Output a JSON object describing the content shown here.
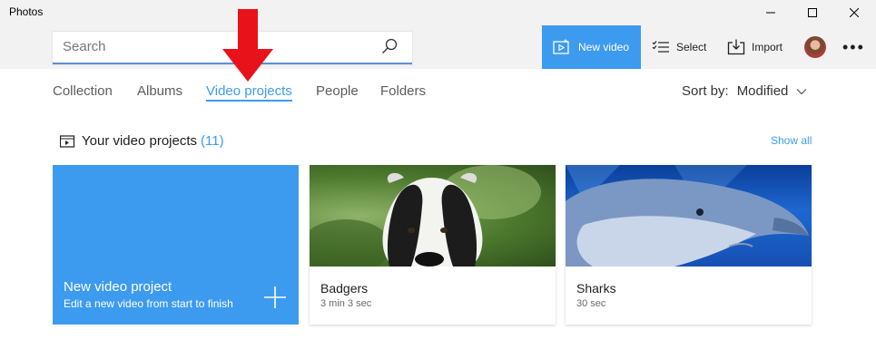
{
  "app": {
    "title": "Photos"
  },
  "search": {
    "placeholder": "Search",
    "value": ""
  },
  "toolbar": {
    "new_video_label": "New video",
    "select_label": "Select",
    "import_label": "Import",
    "more_label": "•••"
  },
  "tabs": [
    {
      "label": "Collection",
      "active": false
    },
    {
      "label": "Albums",
      "active": false
    },
    {
      "label": "Video projects",
      "active": true
    },
    {
      "label": "People",
      "active": false
    },
    {
      "label": "Folders",
      "active": false
    }
  ],
  "sort": {
    "label": "Sort by:",
    "value": "Modified"
  },
  "section": {
    "title": "Your video projects",
    "count": "(11)",
    "show_all": "Show all"
  },
  "cards": {
    "new_project": {
      "title": "New video project",
      "subtitle": "Edit a new video from start to finish"
    },
    "projects": [
      {
        "name": "Badgers",
        "duration": "3 min 3 sec"
      },
      {
        "name": "Sharks",
        "duration": "30 sec"
      }
    ]
  },
  "colors": {
    "accent": "#3d9bef",
    "annotation_arrow": "#e8121b"
  },
  "icons": {
    "search": "search-icon",
    "new_video": "film-icon",
    "select": "checklist-icon",
    "import": "import-icon",
    "sort_chevron": "chevron-down-icon",
    "section": "film-icon",
    "new_card": "plus-icon"
  }
}
